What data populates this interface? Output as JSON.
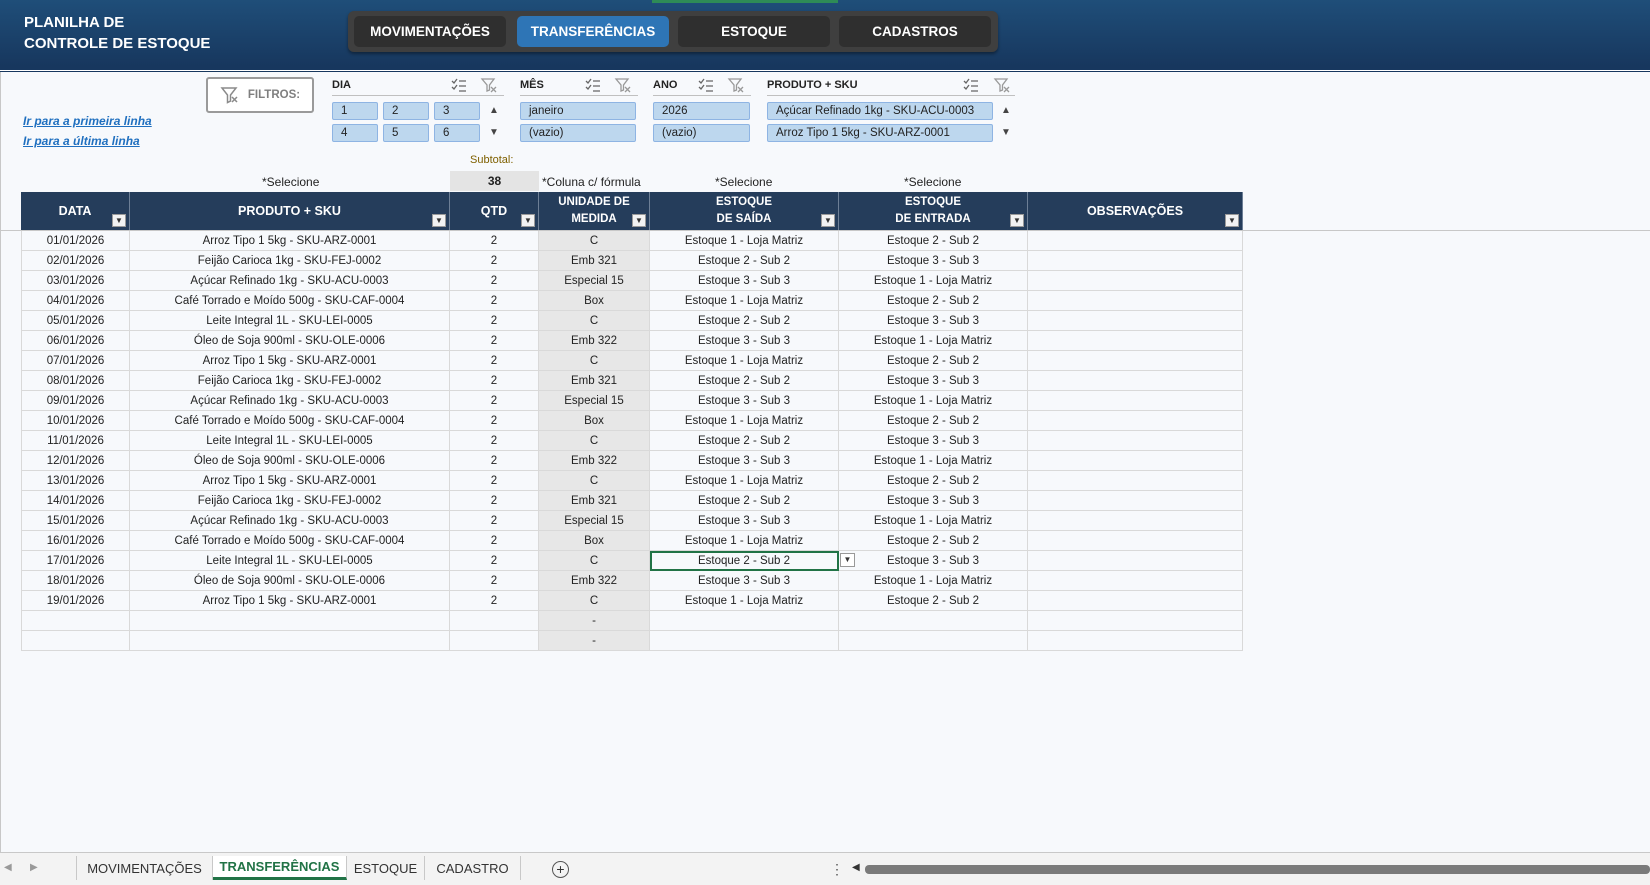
{
  "header": {
    "title_line1": "PLANILHA DE",
    "title_line2": "CONTROLE DE ESTOQUE",
    "nav": [
      "MOVIMENTAÇÕES",
      "TRANSFERÊNCIAS",
      "ESTOQUE",
      "CADASTROS"
    ],
    "active_nav": "TRANSFERÊNCIAS"
  },
  "links": {
    "first_row": "Ir para a primeira linha",
    "last_row": "Ir para a última linha"
  },
  "filters_button": "FILTROS:",
  "slicers": {
    "dia": {
      "title": "DIA",
      "items": [
        "1",
        "2",
        "3",
        "4",
        "5",
        "6"
      ]
    },
    "mes": {
      "title": "MÊS",
      "items": [
        "janeiro",
        "(vazio)"
      ]
    },
    "ano": {
      "title": "ANO",
      "items": [
        "2026",
        "(vazio)"
      ]
    },
    "produto": {
      "title": "PRODUTO + SKU",
      "items": [
        "Açúcar Refinado 1kg - SKU-ACU-0003",
        "Arroz Tipo 1 5kg - SKU-ARZ-0001"
      ]
    }
  },
  "notes": {
    "select1": "*Selecione",
    "formula": "*Coluna c/ fórmula",
    "select2": "*Selecione",
    "select3": "*Selecione",
    "subtotal_label": "Subtotal:",
    "subtotal_value": "38"
  },
  "table": {
    "headers": {
      "data": "DATA",
      "produto": "PRODUTO + SKU",
      "qtd": "QTD",
      "unidade_l1": "UNIDADE DE",
      "unidade_l2": "MEDIDA",
      "saida_l1": "ESTOQUE",
      "saida_l2": "DE SAÍDA",
      "entrada_l1": "ESTOQUE",
      "entrada_l2": "DE ENTRADA",
      "obs": "OBSERVAÇÕES"
    },
    "rows": [
      [
        "01/01/2026",
        "Arroz Tipo 1 5kg - SKU-ARZ-0001",
        "2",
        "C",
        "Estoque 1 - Loja Matriz",
        "Estoque 2 - Sub 2",
        ""
      ],
      [
        "02/01/2026",
        "Feijão Carioca 1kg - SKU-FEJ-0002",
        "2",
        "Emb 321",
        "Estoque 2 - Sub 2",
        "Estoque 3 - Sub 3",
        ""
      ],
      [
        "03/01/2026",
        "Açúcar Refinado 1kg - SKU-ACU-0003",
        "2",
        "Especial 15",
        "Estoque 3 - Sub 3",
        "Estoque 1 - Loja Matriz",
        ""
      ],
      [
        "04/01/2026",
        "Café Torrado e Moído 500g - SKU-CAF-0004",
        "2",
        "Box",
        "Estoque 1 - Loja Matriz",
        "Estoque 2 - Sub 2",
        ""
      ],
      [
        "05/01/2026",
        "Leite Integral 1L - SKU-LEI-0005",
        "2",
        "C",
        "Estoque 2 - Sub 2",
        "Estoque 3 - Sub 3",
        ""
      ],
      [
        "06/01/2026",
        "Óleo de Soja 900ml - SKU-OLE-0006",
        "2",
        "Emb 322",
        "Estoque 3 - Sub 3",
        "Estoque 1 - Loja Matriz",
        ""
      ],
      [
        "07/01/2026",
        "Arroz Tipo 1 5kg - SKU-ARZ-0001",
        "2",
        "C",
        "Estoque 1 - Loja Matriz",
        "Estoque 2 - Sub 2",
        ""
      ],
      [
        "08/01/2026",
        "Feijão Carioca 1kg - SKU-FEJ-0002",
        "2",
        "Emb 321",
        "Estoque 2 - Sub 2",
        "Estoque 3 - Sub 3",
        ""
      ],
      [
        "09/01/2026",
        "Açúcar Refinado 1kg - SKU-ACU-0003",
        "2",
        "Especial 15",
        "Estoque 3 - Sub 3",
        "Estoque 1 - Loja Matriz",
        ""
      ],
      [
        "10/01/2026",
        "Café Torrado e Moído 500g - SKU-CAF-0004",
        "2",
        "Box",
        "Estoque 1 - Loja Matriz",
        "Estoque 2 - Sub 2",
        ""
      ],
      [
        "11/01/2026",
        "Leite Integral 1L - SKU-LEI-0005",
        "2",
        "C",
        "Estoque 2 - Sub 2",
        "Estoque 3 - Sub 3",
        ""
      ],
      [
        "12/01/2026",
        "Óleo de Soja 900ml - SKU-OLE-0006",
        "2",
        "Emb 322",
        "Estoque 3 - Sub 3",
        "Estoque 1 - Loja Matriz",
        ""
      ],
      [
        "13/01/2026",
        "Arroz Tipo 1 5kg - SKU-ARZ-0001",
        "2",
        "C",
        "Estoque 1 - Loja Matriz",
        "Estoque 2 - Sub 2",
        ""
      ],
      [
        "14/01/2026",
        "Feijão Carioca 1kg - SKU-FEJ-0002",
        "2",
        "Emb 321",
        "Estoque 2 - Sub 2",
        "Estoque 3 - Sub 3",
        ""
      ],
      [
        "15/01/2026",
        "Açúcar Refinado 1kg - SKU-ACU-0003",
        "2",
        "Especial 15",
        "Estoque 3 - Sub 3",
        "Estoque 1 - Loja Matriz",
        ""
      ],
      [
        "16/01/2026",
        "Café Torrado e Moído 500g - SKU-CAF-0004",
        "2",
        "Box",
        "Estoque 1 - Loja Matriz",
        "Estoque 2 - Sub 2",
        ""
      ],
      [
        "17/01/2026",
        "Leite Integral 1L - SKU-LEI-0005",
        "2",
        "C",
        "Estoque 2 - Sub 2",
        "Estoque 3 - Sub 3",
        ""
      ],
      [
        "18/01/2026",
        "Óleo de Soja 900ml - SKU-OLE-0006",
        "2",
        "Emb 322",
        "Estoque 3 - Sub 3",
        "Estoque 1 - Loja Matriz",
        ""
      ],
      [
        "19/01/2026",
        "Arroz Tipo 1 5kg - SKU-ARZ-0001",
        "2",
        "C",
        "Estoque 1 - Loja Matriz",
        "Estoque 2 - Sub 2",
        ""
      ],
      [
        "",
        "",
        "",
        "-",
        "",
        "",
        ""
      ],
      [
        "",
        "",
        "",
        "-",
        "",
        "",
        ""
      ]
    ]
  },
  "sheet_tabs": [
    "MOVIMENTAÇÕES",
    "TRANSFERÊNCIAS",
    "ESTOQUE",
    "CADASTRO"
  ],
  "active_sheet": "TRANSFERÊNCIAS",
  "colors": {
    "banner": "#1f4e79",
    "table_header": "#253d5b",
    "slicer_chip": "#bdd7ee",
    "active_tab": "#217346"
  }
}
